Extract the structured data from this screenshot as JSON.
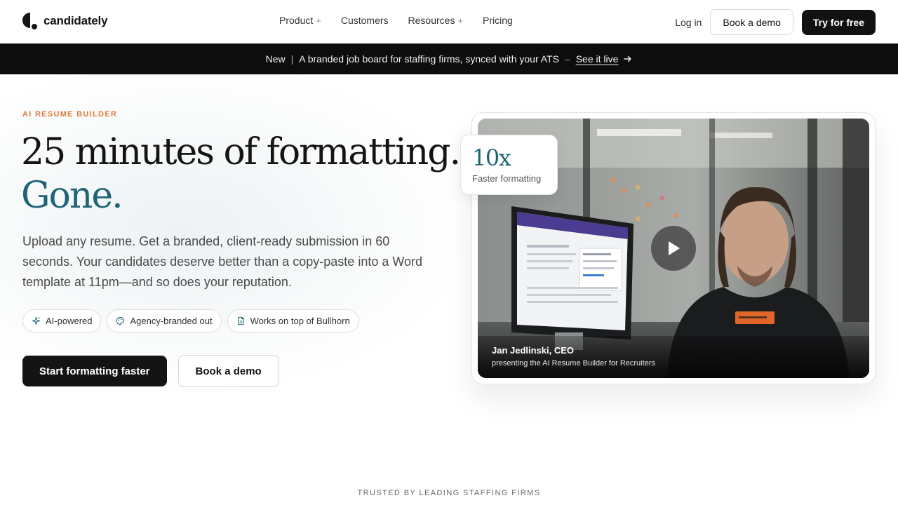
{
  "brand": {
    "name": "candidately"
  },
  "nav": {
    "links": [
      {
        "label": "Product",
        "has_menu": true
      },
      {
        "label": "Customers",
        "has_menu": false
      },
      {
        "label": "Resources",
        "has_menu": true
      },
      {
        "label": "Pricing",
        "has_menu": false
      }
    ],
    "menu_marker": "+",
    "login": "Log in",
    "book_demo": "Book a demo",
    "try_free": "Try for free"
  },
  "banner": {
    "tag": "New",
    "separator": "|",
    "message": "A branded job board for staffing firms, synced with your ATS",
    "dash": "–",
    "cta": "See it live",
    "cta_icon": "arrow-right-icon"
  },
  "hero": {
    "eyebrow": "AI RESUME BUILDER",
    "headline_line1": "25 minutes of formatting.",
    "headline_line2": "Gone.",
    "subcopy": "Upload any resume. Get a branded, client-ready submission in 60 seconds. Your candidates deserve better than a copy-paste into a Word template at 11pm—and so does your reputation.",
    "chips": [
      {
        "label": "AI-powered",
        "icon": "sparkle-icon"
      },
      {
        "label": "Agency-branded out",
        "icon": "palette-icon"
      },
      {
        "label": "Works on top of Bullhorn",
        "icon": "document-icon"
      }
    ],
    "primary_cta": "Start formatting faster",
    "secondary_cta": "Book a demo"
  },
  "video": {
    "stat_value": "10x",
    "stat_label": "Faster formatting",
    "presenter": "Jan Jedlinski, CEO",
    "description": "presenting the AI Resume Builder for Recruiters",
    "play_icon": "play-icon"
  },
  "trusted": "TRUSTED BY LEADING STAFFING FIRMS",
  "colors": {
    "accent_teal": "#1f6476",
    "eyebrow_orange": "#e0783a",
    "dark": "#141414"
  }
}
